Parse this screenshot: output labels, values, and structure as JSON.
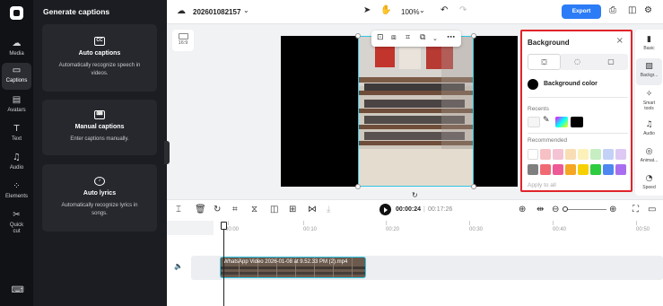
{
  "left_nav": {
    "items": [
      {
        "label": "Media",
        "icon": "cloud-upload-icon"
      },
      {
        "label": "Captions",
        "icon": "captions-icon",
        "active": true
      },
      {
        "label": "Avatars",
        "icon": "avatar-icon"
      },
      {
        "label": "Text",
        "icon": "text-icon"
      },
      {
        "label": "Audio",
        "icon": "music-icon"
      },
      {
        "label": "Elements",
        "icon": "elements-icon"
      },
      {
        "label": "Quick cut",
        "icon": "quick-cut-icon"
      }
    ]
  },
  "captions_panel": {
    "title": "Generate captions",
    "cards": [
      {
        "title": "Auto captions",
        "desc": "Automatically recognize speech in videos.",
        "icon": "cc-icon"
      },
      {
        "title": "Manual captions",
        "desc": "Enter captions manually.",
        "icon": "keyboard-icon"
      },
      {
        "title": "Auto lyrics",
        "desc": "Automatically recognize lyrics in songs.",
        "icon": "lyrics-icon"
      }
    ]
  },
  "topbar": {
    "project_name": "202601082157",
    "zoom": "100%",
    "export_label": "Export"
  },
  "canvas": {
    "ratio_label": "16:9"
  },
  "background_panel": {
    "title": "Background",
    "color_label": "Background color",
    "recents_label": "Recents",
    "recommended_label": "Recommended",
    "apply_label": "Apply to all",
    "recent_colors": [
      "#ffffff",
      "#000000"
    ],
    "recommended_colors": [
      "#ffffff",
      "#f7c0c4",
      "#f4c3d4",
      "#f8ddb5",
      "#fbf1b9",
      "#c6eec2",
      "#c3d1f6",
      "#ddc9f4",
      "#7f7f7f",
      "#f06a74",
      "#ed5a95",
      "#f5a623",
      "#f7d000",
      "#2ecc40",
      "#4f87f0",
      "#a96ef0"
    ]
  },
  "right_rail": {
    "items": [
      {
        "label": "Basic",
        "icon": "basic-icon"
      },
      {
        "label": "Backgr...",
        "icon": "background-icon",
        "active": true
      },
      {
        "label": "Smart tools",
        "icon": "magic-wand-icon"
      },
      {
        "label": "Audio",
        "icon": "music-icon"
      },
      {
        "label": "Animat...",
        "icon": "animation-icon"
      },
      {
        "label": "Speed",
        "icon": "speed-icon"
      }
    ]
  },
  "timeline": {
    "current_time": "00:00:24",
    "total_time": "00:17:26",
    "ticks": [
      "00:00",
      "00:10",
      "00:20",
      "00:30",
      "00:40",
      "00:50"
    ],
    "clip_name": "WhatsApp Video 2026-01-08 at 9.52.33 PM (2).mp4"
  }
}
